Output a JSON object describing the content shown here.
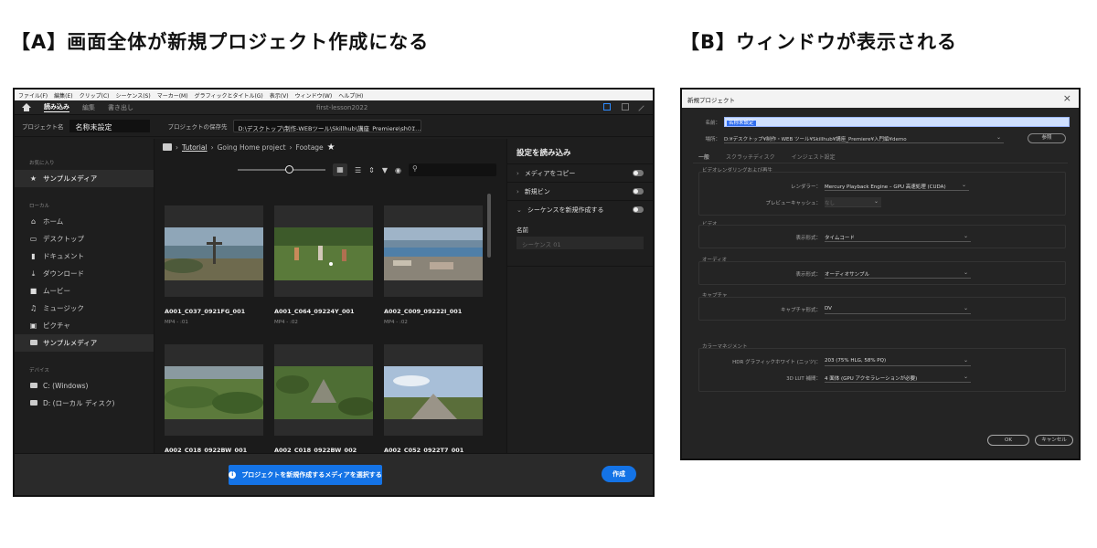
{
  "headings": {
    "a": "【A】画面全体が新規プロジェクト作成になる",
    "b": "【B】ウィンドウが表示される"
  },
  "panel_a": {
    "menu": [
      "ファイル(F)",
      "編集(E)",
      "クリップ(C)",
      "シーケンス(S)",
      "マーカー(M)",
      "グラフィックとタイトル(G)",
      "表示(V)",
      "ウィンドウ(W)",
      "ヘルプ(H)"
    ],
    "mode_tabs": [
      "読み込み",
      "編集",
      "書き出し"
    ],
    "window_title": "first-lesson2022",
    "project_name_label": "プロジェクト名",
    "project_name_value": "名称未設定",
    "save_location_label": "プロジェクトの保存先",
    "save_location_value": "D:\\デスクトップ\\制作-WEBツール\\Skillhub\\講座_Premiere\\sh01...",
    "sidebar": {
      "favorites_label": "お気に入り",
      "favorites": [
        "サンプルメディア"
      ],
      "local_label": "ローカル",
      "local": [
        "ホーム",
        "デスクトップ",
        "ドキュメント",
        "ダウンロード",
        "ムービー",
        "ミュージック",
        "ピクチャ",
        "サンプルメディア"
      ],
      "devices_label": "デバイス",
      "devices": [
        "C: (Windows)",
        "D: (ローカル ディスク)"
      ]
    },
    "breadcrumb": {
      "root": "Tutorial",
      "middle": "Going Home project",
      "current": "Footage"
    },
    "media": [
      {
        "name": "A001_C037_0921FG_001",
        "meta": "MP4 - :01"
      },
      {
        "name": "A001_C064_09224Y_001",
        "meta": "MP4 - :02"
      },
      {
        "name": "A002_C009_09222I_001",
        "meta": "MP4 - :02"
      },
      {
        "name": "A002_C018_0922BW_001",
        "meta": ""
      },
      {
        "name": "A002_C018_0922BW_002",
        "meta": ""
      },
      {
        "name": "A002_C052_0922T7_001",
        "meta": ""
      }
    ],
    "right_panel": {
      "title": "設定を読み込み",
      "copy_media": "メディアをコピー",
      "new_bin": "新規ビン",
      "create_sequence": "シーケンスを新規作成する",
      "name_label": "名前",
      "name_placeholder": "シーケンス 01"
    },
    "select_media_button": "プロジェクトを新規作成するメディアを選択する",
    "create_button": "作成"
  },
  "panel_b": {
    "title": "新規プロジェクト",
    "name_label": "名前：",
    "name_value": "名称未設定",
    "location_label": "場所：",
    "location_value": "D:¥デスクトップ¥制作・WEB ツール¥Skillhub¥講座_Premiere¥入門編¥demo",
    "browse_button": "参照",
    "tabs": [
      "一般",
      "スクラッチディスク",
      "インジェスト設定"
    ],
    "video_rendering_title": "ビデオレンダリングおよび再生",
    "renderer_label": "レンダラー：",
    "renderer_value": "Mercury Playback Engine – GPU 高速処理 (CUDA)",
    "preview_cache_label": "プレビューキャッシュ：",
    "preview_cache_value": "なし",
    "video_title": "ビデオ",
    "video_display_label": "表示形式：",
    "video_display_value": "タイムコード",
    "audio_title": "オーディオ",
    "audio_display_label": "表示形式：",
    "audio_display_value": "オーディオサンプル",
    "capture_title": "キャプチャ",
    "capture_label": "キャプチャ形式：",
    "capture_value": "DV",
    "color_title": "カラーマネジメント",
    "hdr_label": "HDR グラフィックホワイト (ニッツ)：",
    "hdr_value": "203 (75% HLG, 58% PQ)",
    "lut_label": "3D LUT 補間：",
    "lut_value": "4 面体 (GPU アクセラレーションが必要)",
    "ok_button": "OK",
    "cancel_button": "キャンセル"
  }
}
